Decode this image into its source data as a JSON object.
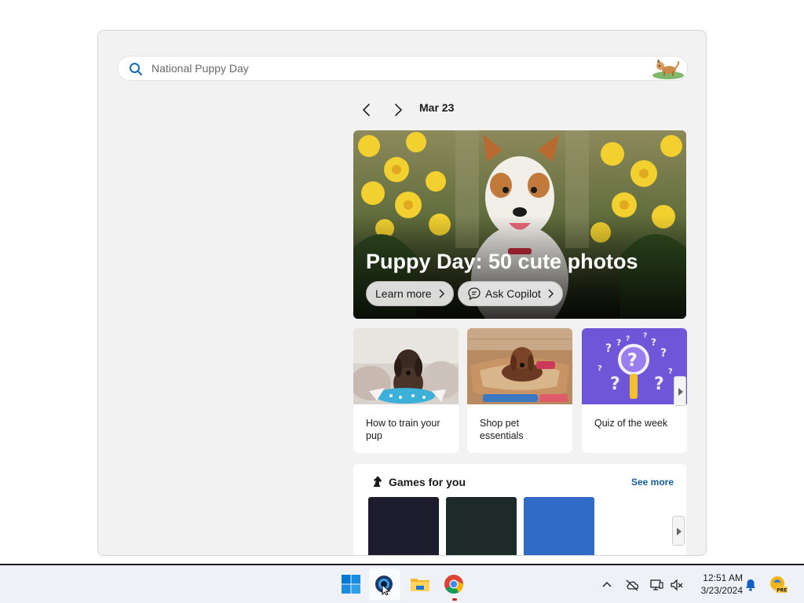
{
  "search": {
    "placeholder": "National Puppy Day"
  },
  "nav": {
    "date": "Mar 23"
  },
  "hero": {
    "title": "Puppy Day: 50 cute photos",
    "learn_more": "Learn more",
    "ask_copilot": "Ask Copilot"
  },
  "cards": [
    {
      "label": "How to train your pup"
    },
    {
      "label": "Shop pet essentials"
    },
    {
      "label": "Quiz of the week"
    }
  ],
  "games": {
    "title": "Games for you",
    "see_more": "See more"
  },
  "taskbar": {
    "time": "12:51 AM",
    "date": "3/23/2024",
    "icons": [
      "windows-start-icon",
      "edge-icon",
      "file-explorer-icon",
      "chrome-icon"
    ]
  },
  "colors": {
    "accent": "#115ea3",
    "taskbar": "#eef1f6",
    "panel": "#f2f2f2"
  }
}
